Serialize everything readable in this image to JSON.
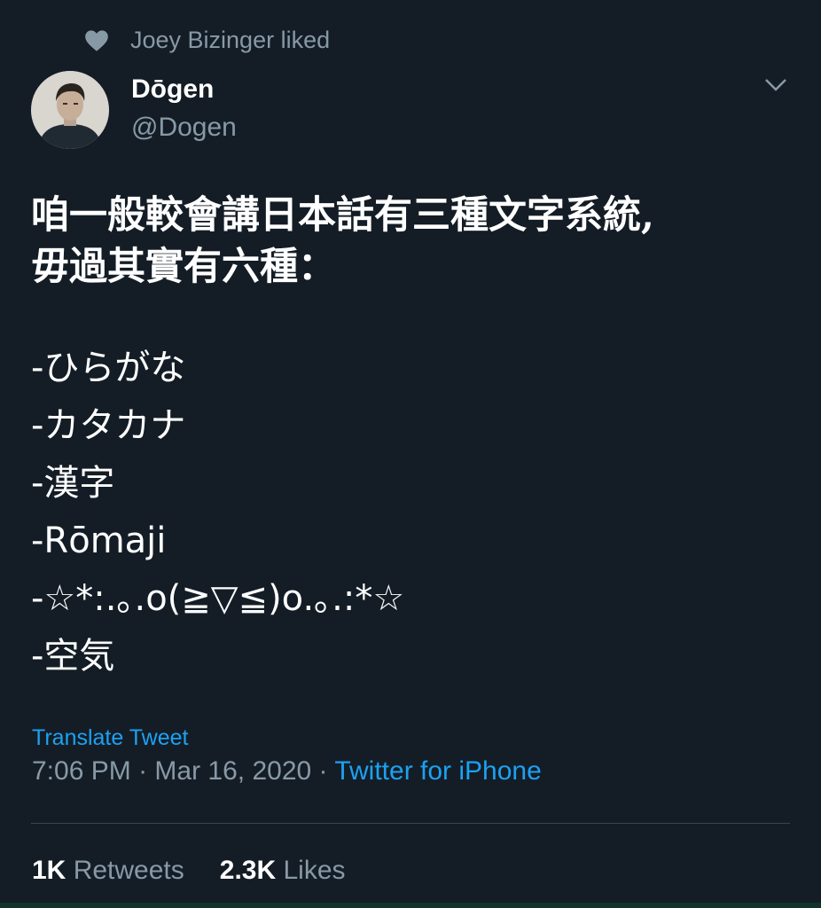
{
  "social_context": {
    "icon": "heart-icon",
    "text": "Joey Bizinger liked"
  },
  "author": {
    "display_name": "Dōgen",
    "handle": "@Dogen"
  },
  "tweet": {
    "lines": [
      "咱一般較會講日本話有三種文字系統,",
      "毋過其實有六種："
    ],
    "list_items": [
      "-ひらがな",
      "-カタカナ",
      "-漢字",
      "-Rōmaji",
      "-☆*:.｡.o(≧▽≦)o.｡.:*☆",
      "-空気"
    ],
    "translate_label": "Translate Tweet"
  },
  "meta": {
    "time": "7:06 PM",
    "separator": "·",
    "date": "Mar 16, 2020",
    "source": "Twitter for iPhone"
  },
  "stats": {
    "retweets_count": "1K",
    "retweets_label": "Retweets",
    "likes_count": "2.3K",
    "likes_label": "Likes"
  },
  "colors": {
    "background": "#141d26",
    "secondary_text": "#8899a6",
    "link": "#1da1f2",
    "primary_text": "#ffffff"
  }
}
